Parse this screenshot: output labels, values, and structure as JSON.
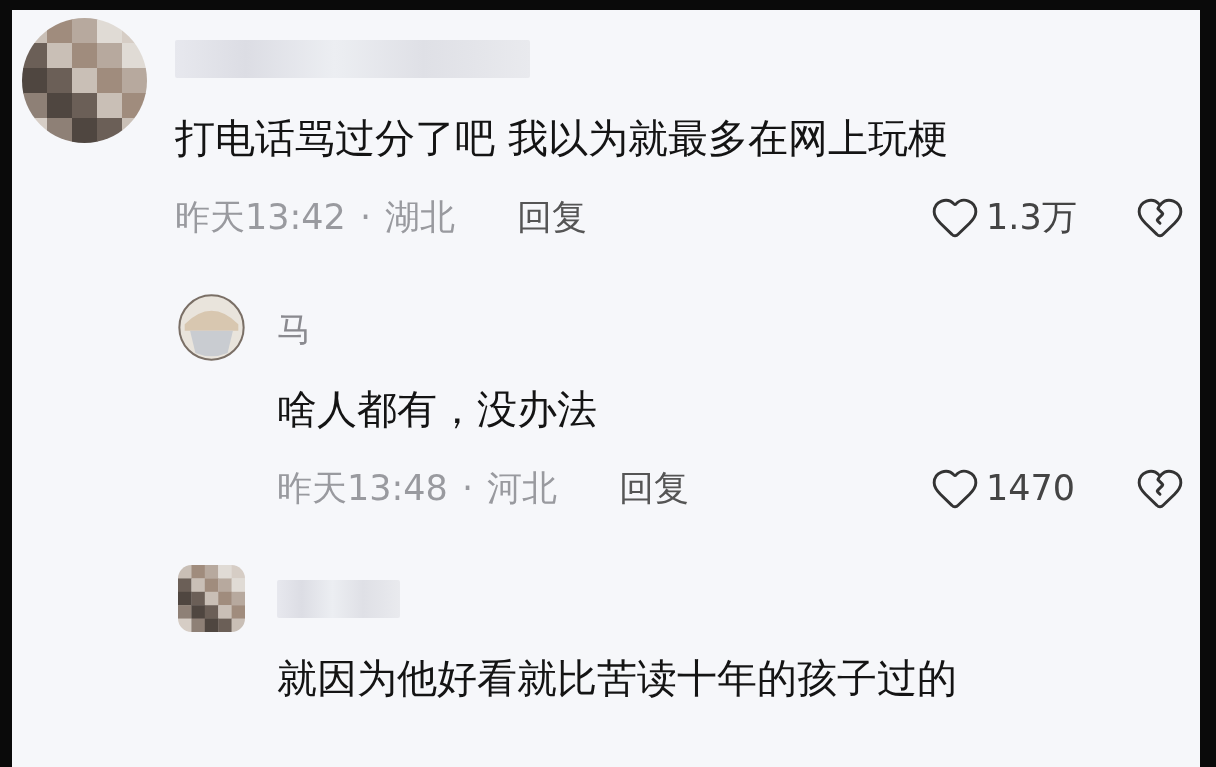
{
  "comments": [
    {
      "avatar": {
        "kind": "pixelated"
      },
      "name_blurred": true,
      "text": "打电话骂过分了吧 我以为就最多在网上玩梗",
      "time": "昨天13:42",
      "separator": "·",
      "location": "湖北",
      "reply": "回复",
      "likes": "1.3万",
      "replies": [
        {
          "avatar": {
            "kind": "cartoon"
          },
          "name_blurred": false,
          "name": "马",
          "text": "啥人都有，没办法",
          "time": "昨天13:48",
          "separator": "·",
          "location": "河北",
          "reply": "回复",
          "likes": "1470"
        },
        {
          "avatar": {
            "kind": "pixelated"
          },
          "name_blurred": true,
          "text": "就因为他好看就比苦读十年的孩子过的"
        }
      ]
    }
  ]
}
